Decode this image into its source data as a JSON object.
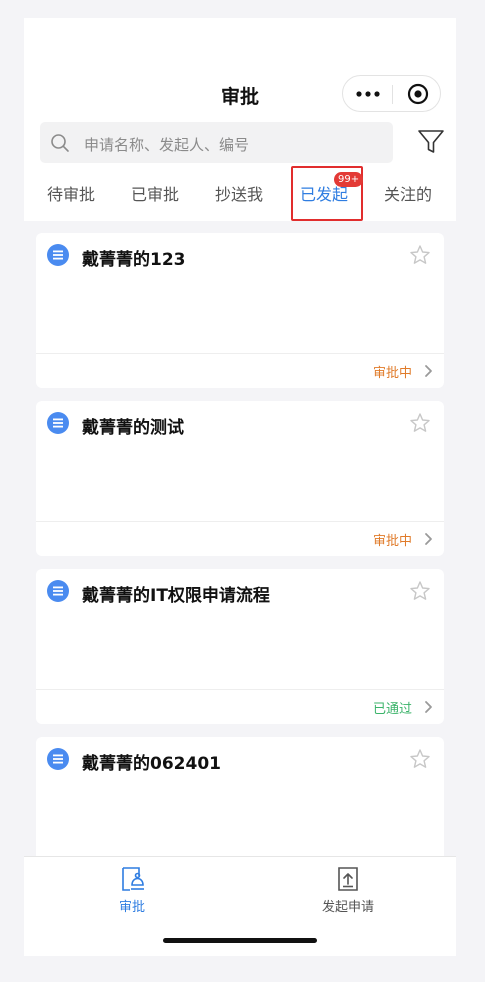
{
  "header": {
    "title": "审批",
    "capsule": {
      "more_icon": "more-dots-icon",
      "close_icon": "target-circle-icon"
    }
  },
  "search": {
    "icon": "search-icon",
    "placeholder": "申请名称、发起人、编号",
    "filter_icon": "filter-funnel-icon"
  },
  "tabs": [
    {
      "label": "待审批"
    },
    {
      "label": "已审批"
    },
    {
      "label": "抄送我"
    },
    {
      "label": "已发起",
      "active": true,
      "badge": "99+"
    },
    {
      "label": "关注的"
    }
  ],
  "cards": [
    {
      "title": "戴菁菁的123",
      "status": "审批中"
    },
    {
      "title": "戴菁菁的测试",
      "status": "审批中"
    },
    {
      "title": "戴菁菁的IT权限申请流程",
      "status": "已通过"
    },
    {
      "title": "戴菁菁的062401",
      "status": ""
    }
  ],
  "tabbar": [
    {
      "label": "审批",
      "icon": "approval-doc-icon",
      "active": true
    },
    {
      "label": "发起申请",
      "icon": "upload-doc-icon",
      "active": false
    }
  ],
  "colors": {
    "accent": "#2f7de1",
    "status_pending": "#e07b2a",
    "status_approved": "#3bb36a",
    "highlight_box": "#e12d2d",
    "badge": "#e33a36"
  }
}
